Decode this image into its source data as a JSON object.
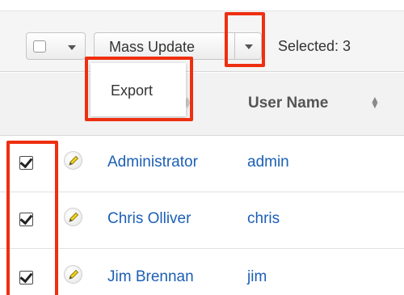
{
  "toolbar": {
    "mass_update_label": "Mass Update",
    "selected_label": "Selected:",
    "selected_count": "3",
    "selected_text": "Selected:  3"
  },
  "actions_menu": {
    "items": [
      {
        "label": "Export"
      }
    ]
  },
  "table": {
    "columns": [
      {
        "label": "User Name",
        "sortable": true
      }
    ],
    "rows": [
      {
        "full_name": "Administrator",
        "user_name": "admin",
        "checked": true,
        "edit_icon": "pencil-icon"
      },
      {
        "full_name": "Chris Olliver",
        "user_name": "chris",
        "checked": true,
        "edit_icon": "pencil-icon"
      },
      {
        "full_name": "Jim Brennan",
        "user_name": "jim",
        "checked": true,
        "edit_icon": "pencil-icon"
      }
    ]
  },
  "colors": {
    "highlight": "#ee2f10",
    "link": "#1c5fb5",
    "pencil": "#f2d21a"
  }
}
